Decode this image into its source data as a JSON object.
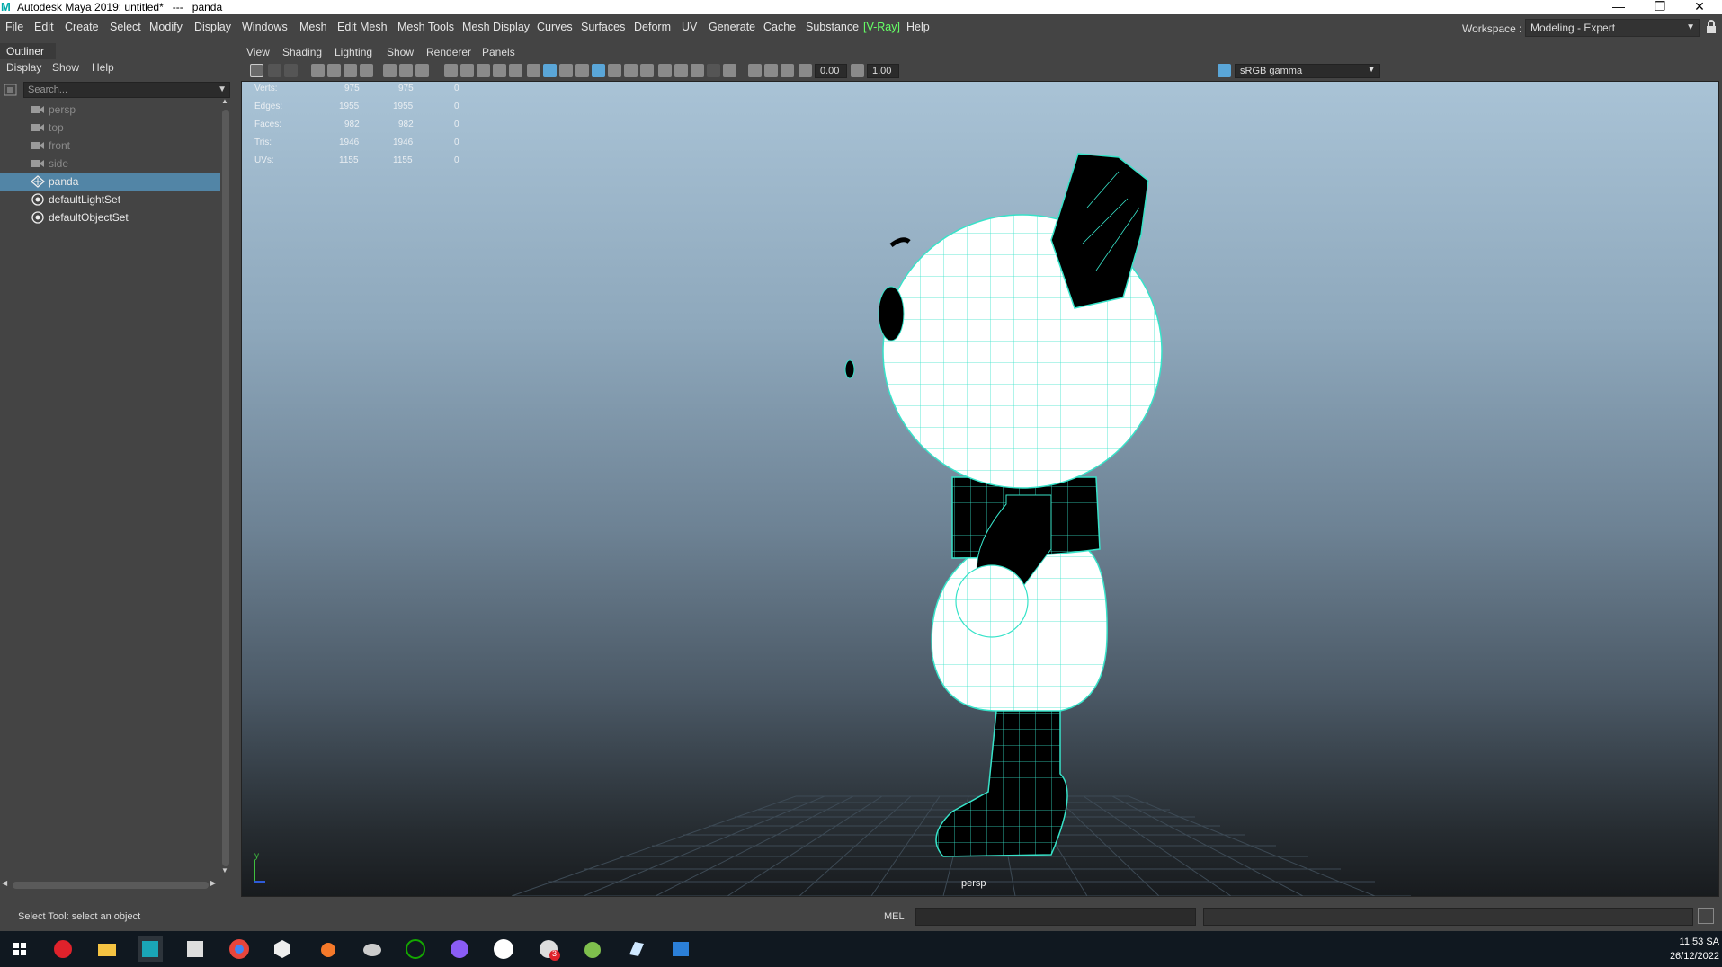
{
  "window": {
    "title": "Autodesk Maya 2019: untitled*   ---   panda",
    "logo_letter": "M",
    "minimize": "—",
    "restore": "❐",
    "close": "✕"
  },
  "menubar": {
    "items": [
      "File",
      "Edit",
      "Create",
      "Select",
      "Modify",
      "Display",
      "Windows",
      "Mesh",
      "Edit Mesh",
      "Mesh Tools",
      "Mesh Display",
      "Curves",
      "Surfaces",
      "Deform",
      "UV",
      "Generate",
      "Cache",
      "Substance",
      "[V-Ray]",
      "Help"
    ],
    "workspace_label": "Workspace :",
    "workspace_value": "Modeling - Expert"
  },
  "outliner": {
    "title": "Outliner",
    "menu": [
      "Display",
      "Show",
      "Help"
    ],
    "search_placeholder": "Search...",
    "items": [
      {
        "label": "persp",
        "icon": "camera-icon"
      },
      {
        "label": "top",
        "icon": "camera-icon"
      },
      {
        "label": "front",
        "icon": "camera-icon"
      },
      {
        "label": "side",
        "icon": "camera-icon"
      },
      {
        "label": "panda",
        "icon": "mesh-icon",
        "selected": true
      },
      {
        "label": "defaultLightSet",
        "icon": "set-icon"
      },
      {
        "label": "defaultObjectSet",
        "icon": "set-icon"
      }
    ]
  },
  "viewport": {
    "menu": [
      "View",
      "Shading",
      "Lighting",
      "Show",
      "Renderer",
      "Panels"
    ],
    "exposure": "0.00",
    "gamma": "1.00",
    "color_space": "sRGB gamma",
    "camera": "persp",
    "hud": [
      {
        "label": "Verts:",
        "a": "975",
        "b": "975",
        "c": "0"
      },
      {
        "label": "Edges:",
        "a": "1955",
        "b": "1955",
        "c": "0"
      },
      {
        "label": "Faces:",
        "a": "982",
        "b": "982",
        "c": "0"
      },
      {
        "label": "Tris:",
        "a": "1946",
        "b": "1946",
        "c": "0"
      },
      {
        "label": "UVs:",
        "a": "1155",
        "b": "1155",
        "c": "0"
      }
    ],
    "axis_y": "y",
    "accent_wire": "#37e3c9"
  },
  "statusline": {
    "help_text": "Select Tool: select an object",
    "mel_label": "MEL"
  },
  "taskbar": {
    "time": "11:53 SA",
    "date": "26/12/2022",
    "badge": "3"
  }
}
